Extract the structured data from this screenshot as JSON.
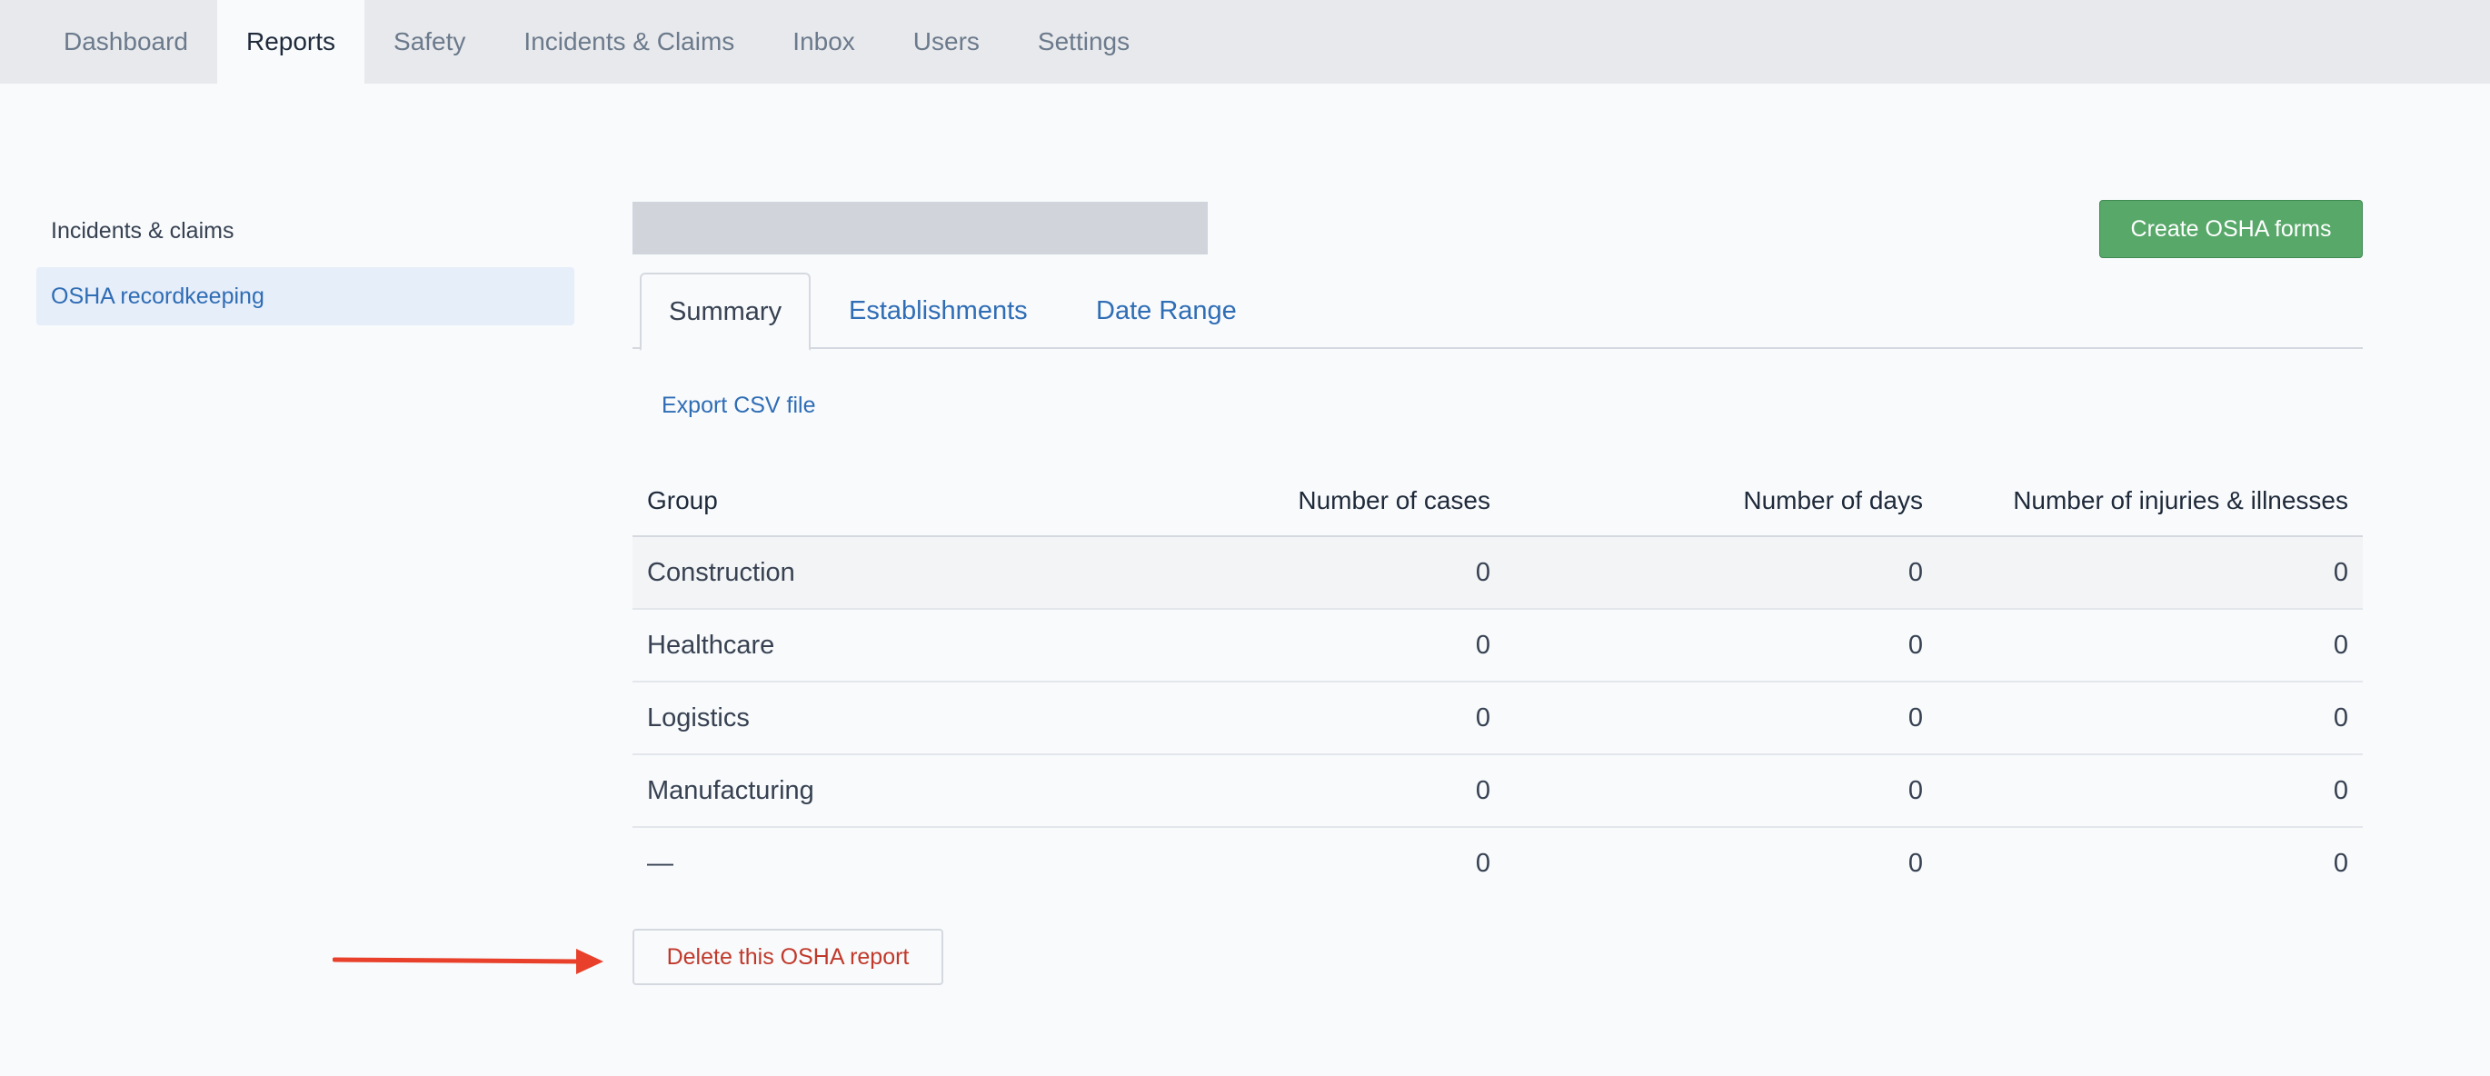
{
  "topnav": {
    "items": [
      {
        "label": "Dashboard"
      },
      {
        "label": "Reports"
      },
      {
        "label": "Safety"
      },
      {
        "label": "Incidents & Claims"
      },
      {
        "label": "Inbox"
      },
      {
        "label": "Users"
      },
      {
        "label": "Settings"
      }
    ],
    "active": "Reports"
  },
  "sidebar": {
    "items": [
      {
        "label": "Incidents & claims"
      },
      {
        "label": "OSHA recordkeeping"
      }
    ],
    "active": "OSHA recordkeeping"
  },
  "main": {
    "create_button": "Create OSHA forms",
    "tabs": [
      {
        "label": "Summary"
      },
      {
        "label": "Establishments"
      },
      {
        "label": "Date Range"
      }
    ],
    "active_tab": "Summary",
    "export_link": "Export CSV file",
    "table": {
      "headers": [
        "Group",
        "Number of cases",
        "Number of days",
        "Number of injuries & illnesses"
      ],
      "rows": [
        {
          "group": "Construction",
          "cases": "0",
          "days": "0",
          "injuries": "0"
        },
        {
          "group": "Healthcare",
          "cases": "0",
          "days": "0",
          "injuries": "0"
        },
        {
          "group": "Logistics",
          "cases": "0",
          "days": "0",
          "injuries": "0"
        },
        {
          "group": "Manufacturing",
          "cases": "0",
          "days": "0",
          "injuries": "0"
        },
        {
          "group": "—",
          "cases": "0",
          "days": "0",
          "injuries": "0"
        }
      ]
    },
    "delete_button": "Delete this OSHA report"
  },
  "colors": {
    "accent": "#2f6db5",
    "primary_button": "#58a86a",
    "danger": "#c0392b",
    "annotation_arrow": "#e8402a"
  }
}
